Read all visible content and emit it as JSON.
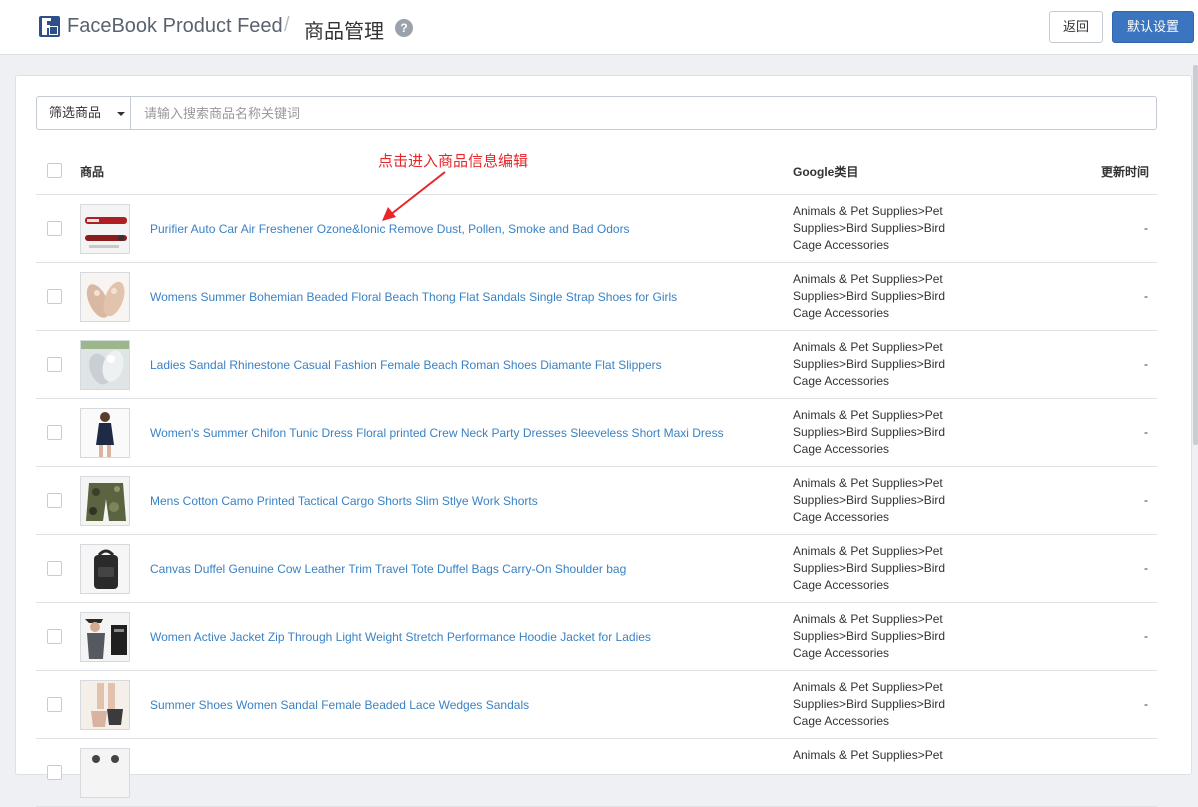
{
  "header": {
    "app_name": "FaceBook Product Feed",
    "separator": "/",
    "page_title": "商品管理",
    "help_label": "?",
    "back_label": "返回",
    "default_settings_label": "默认设置"
  },
  "toolbar": {
    "filter_label": "筛选商品",
    "search_placeholder": "请输入搜索商品名称关键词"
  },
  "table": {
    "columns": {
      "product": "商品",
      "google_category": "Google类目",
      "updated_time": "更新时间"
    },
    "rows": [
      {
        "title": "Purifier Auto Car Air Freshener Ozone&Ionic Remove Dust, Pollen, Smoke and Bad Odors",
        "category": "Animals & Pet Supplies>Pet Supplies>Bird Supplies>Bird Cage Accessories",
        "updated": "-"
      },
      {
        "title": "Womens Summer Bohemian Beaded Floral Beach Thong Flat Sandals Single Strap Shoes for Girls",
        "category": "Animals & Pet Supplies>Pet Supplies>Bird Supplies>Bird Cage Accessories",
        "updated": "-"
      },
      {
        "title": "Ladies Sandal Rhinestone Casual Fashion Female Beach Roman Shoes Diamante Flat Slippers",
        "category": "Animals & Pet Supplies>Pet Supplies>Bird Supplies>Bird Cage Accessories",
        "updated": "-"
      },
      {
        "title": "Women's Summer Chifon Tunic Dress Floral printed Crew Neck Party Dresses Sleeveless Short Maxi Dress",
        "category": "Animals & Pet Supplies>Pet Supplies>Bird Supplies>Bird Cage Accessories",
        "updated": "-"
      },
      {
        "title": "Mens Cotton Camo Printed Tactical Cargo Shorts Slim Stlye Work Shorts",
        "category": "Animals & Pet Supplies>Pet Supplies>Bird Supplies>Bird Cage Accessories",
        "updated": "-"
      },
      {
        "title": "Canvas Duffel Genuine Cow Leather Trim Travel Tote Duffel Bags Carry-On Shoulder bag",
        "category": "Animals & Pet Supplies>Pet Supplies>Bird Supplies>Bird Cage Accessories",
        "updated": "-"
      },
      {
        "title": "Women Active Jacket Zip Through Light Weight Stretch Performance Hoodie Jacket for Ladies",
        "category": "Animals & Pet Supplies>Pet Supplies>Bird Supplies>Bird Cage Accessories",
        "updated": "-"
      },
      {
        "title": "Summer Shoes Women Sandal Female Beaded Lace Wedges Sandals",
        "category": "Animals & Pet Supplies>Pet Supplies>Bird Supplies>Bird Cage Accessories",
        "updated": "-"
      },
      {
        "title": "",
        "category": "Animals & Pet Supplies>Pet",
        "updated": ""
      }
    ]
  },
  "annotation": {
    "text": "点击进入商品信息编辑",
    "color": "#e8262a"
  },
  "colors": {
    "link": "#3a82c4",
    "primary_button": "#3b75c0"
  }
}
